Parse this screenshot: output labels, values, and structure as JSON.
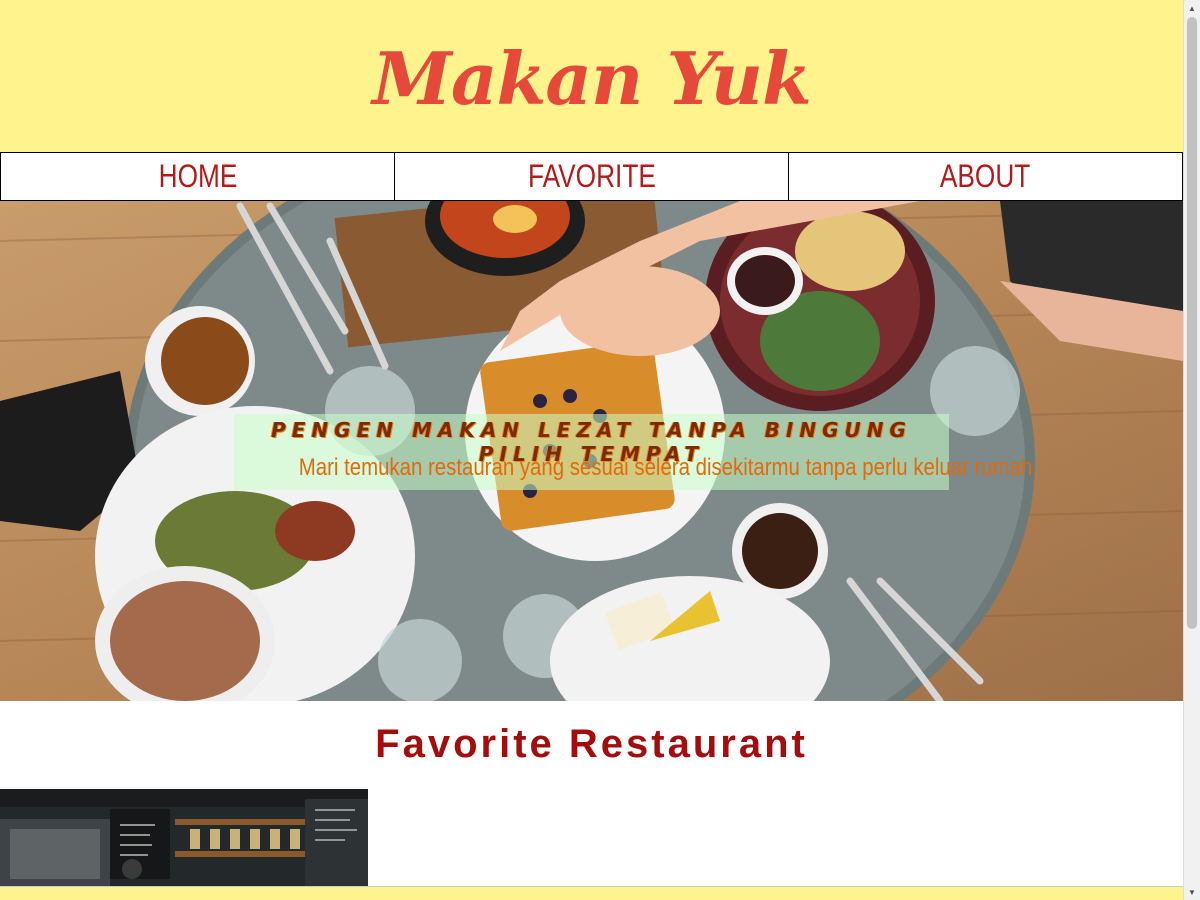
{
  "header": {
    "brand": "Makan Yuk"
  },
  "nav": {
    "items": [
      "HOME",
      "FAVORITE",
      "ABOUT"
    ]
  },
  "hero": {
    "title": "PENGEN MAKAN LEZAT TANPA BINGUNG PILIH TEMPAT",
    "subtitle": "Mari temukan restauran yang sesuai selera disekitarmu tanpa perlu keluar rumah"
  },
  "section": {
    "title": "Favorite Restaurant"
  },
  "colors": {
    "header_bg": "#fff38e",
    "brand": "#e5493a",
    "nav_text": "#b31b1b",
    "section_title": "#a30d0d",
    "hero_subtitle": "#e26a0a"
  },
  "icons": {
    "scroll_up": "scroll-up-arrow-icon",
    "scroll_down": "scroll-down-arrow-icon"
  }
}
